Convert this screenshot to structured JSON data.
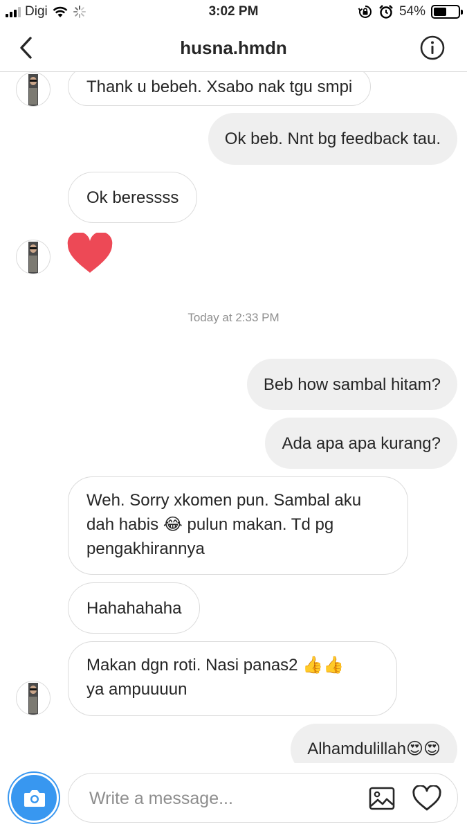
{
  "status_bar": {
    "carrier": "Digi",
    "time": "3:02 PM",
    "battery_percent": "54%",
    "battery_level": 0.54,
    "icons": [
      "signal-icon",
      "wifi-icon",
      "loading-icon",
      "rotation-lock-icon",
      "alarm-icon",
      "battery-icon"
    ]
  },
  "header": {
    "title": "husna.hmdn",
    "back_icon": "chevron-left-icon",
    "info_icon": "info-icon"
  },
  "messages": [
    {
      "direction": "in",
      "lines": [
        "Thank u bebeh. Xsabo nak tgu smpi"
      ]
    },
    {
      "direction": "out",
      "lines": [
        "Ok beb. Nnt bg feedback tau."
      ]
    },
    {
      "direction": "in",
      "lines": [
        "Ok beressss"
      ]
    },
    {
      "direction": "in",
      "type": "heart",
      "icon": "heart-icon"
    },
    {
      "direction": "out",
      "lines": [
        "Beb how sambal hitam?"
      ]
    },
    {
      "direction": "out",
      "lines": [
        "Ada apa apa kurang?"
      ]
    },
    {
      "direction": "in",
      "lines": [
        "Weh. Sorry xkomen pun. Sambal aku",
        "dah habis 😂 pulun makan. Td pg",
        "pengakhirannya"
      ]
    },
    {
      "direction": "in",
      "lines": [
        "Hahahahaha"
      ]
    },
    {
      "direction": "in",
      "lines": [
        "Makan dgn roti. Nasi panas2 👍👍",
        "ya ampuuuun"
      ]
    },
    {
      "direction": "out",
      "lines": [
        "Alhamdulillah😍😍"
      ]
    }
  ],
  "timestamp": "Today at 2:33 PM",
  "composer": {
    "placeholder": "Write a message...",
    "camera_icon": "camera-icon",
    "gallery_icon": "gallery-icon",
    "like_icon": "heart-icon"
  },
  "colors": {
    "accent": "#3897f0",
    "heart": "#ed4956",
    "outgoing_bubble": "#efefef",
    "incoming_border": "#dbdbdb",
    "timestamp": "#8e8e8e"
  }
}
